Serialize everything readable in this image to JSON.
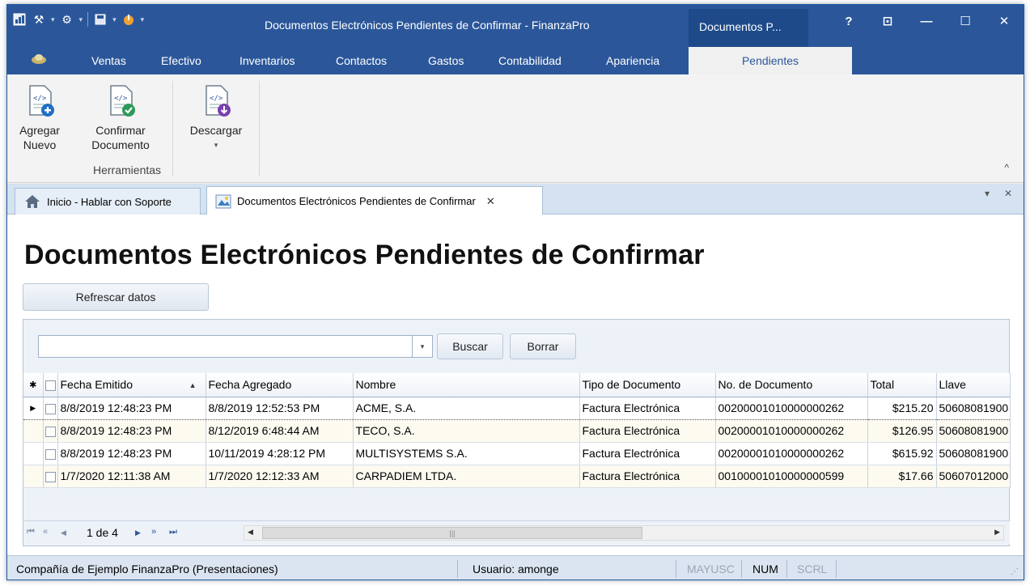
{
  "window": {
    "title": "Documentos Electrónicos Pendientes de Confirmar - FinanzaPro",
    "context_tab_title": "Documentos P...",
    "buttons": {
      "help": "?",
      "restore_ribbon": "⊡",
      "minimize": "—",
      "maximize": "☐",
      "close": "✕"
    }
  },
  "quick_access": [
    {
      "icon": "app-icon"
    },
    {
      "icon": "tools-icon"
    },
    {
      "icon": "gear-icon"
    },
    {
      "icon": "save-icon"
    },
    {
      "icon": "touch-icon"
    }
  ],
  "ribbon_tabs": [
    "Ventas",
    "Efectivo",
    "Inventarios",
    "Contactos",
    "Gastos",
    "Contabilidad",
    "Apariencia",
    "Pendientes"
  ],
  "ribbon_active_tab": "Pendientes",
  "ribbon": {
    "buttons": [
      {
        "label_line1": "Agregar",
        "label_line2": "Nuevo"
      },
      {
        "label_line1": "Confirmar",
        "label_line2": "Documento"
      },
      {
        "label_line1": "Descargar",
        "label_line2": "▾"
      }
    ],
    "group_label": "Herramientas",
    "collapse": "^"
  },
  "doc_tabs": [
    {
      "label": "Inicio - Hablar con Soporte"
    },
    {
      "label": "Documentos Electrónicos Pendientes de Confirmar",
      "close": "✕"
    }
  ],
  "doc_controls": {
    "menu": "▾",
    "close": "✕"
  },
  "page": {
    "title": "Documentos Electrónicos Pendientes de Confirmar",
    "refresh_label": "Refrescar datos"
  },
  "search": {
    "value": "",
    "dropdown": "▾",
    "buscar_label": "Buscar",
    "borrar_label": "Borrar"
  },
  "grid": {
    "header_marker": "✱",
    "columns": [
      "Fecha Emitido",
      "Fecha Agregado",
      "Nombre",
      "Tipo de Documento",
      "No. de Documento",
      "Total",
      "Llave"
    ],
    "sorted_column": "Fecha Emitido",
    "sort_direction": "▲",
    "current_row_marker": "▶",
    "rows": [
      {
        "emitido": "8/8/2019 12:48:23 PM",
        "agregado": "8/8/2019 12:52:53 PM",
        "nombre": "ACME, S.A.",
        "tipo": "Factura Electrónica",
        "numero": "00200001010000000262",
        "total": "$215.20",
        "llave": "50608081900"
      },
      {
        "emitido": "8/8/2019 12:48:23 PM",
        "agregado": "8/12/2019 6:48:44 AM",
        "nombre": "TECO, S.A.",
        "tipo": "Factura Electrónica",
        "numero": "00200001010000000262",
        "total": "$126.95",
        "llave": "50608081900"
      },
      {
        "emitido": "8/8/2019 12:48:23 PM",
        "agregado": "10/11/2019 4:28:12 PM",
        "nombre": "MULTISYSTEMS S.A.",
        "tipo": "Factura Electrónica",
        "numero": "00200001010000000262",
        "total": "$615.92",
        "llave": "50608081900"
      },
      {
        "emitido": "1/7/2020 12:11:38 AM",
        "agregado": "1/7/2020 12:12:33 AM",
        "nombre": "CARPADIEM LTDA.",
        "tipo": "Factura Electrónica",
        "numero": "00100001010000000599",
        "total": "$17.66",
        "llave": "50607012000"
      }
    ]
  },
  "pager": {
    "first": "⏮",
    "prev_page": "«",
    "prev": "◀",
    "text": "1 de 4",
    "next": "▶",
    "next_page": "»",
    "last": "⏭",
    "scroll_left": "◀",
    "scroll_thumb": "|||",
    "scroll_right": "▶"
  },
  "status": {
    "company": "Compañía de Ejemplo FinanzaPro (Presentaciones)",
    "user": "Usuario: amonge",
    "mayusc": "MAYUSC",
    "num": "NUM",
    "scrl": "SCRL"
  },
  "colors": {
    "accent": "#2b579a",
    "status_bg": "#dbe5f1",
    "grid_alt_row": "#fdfaf0"
  }
}
